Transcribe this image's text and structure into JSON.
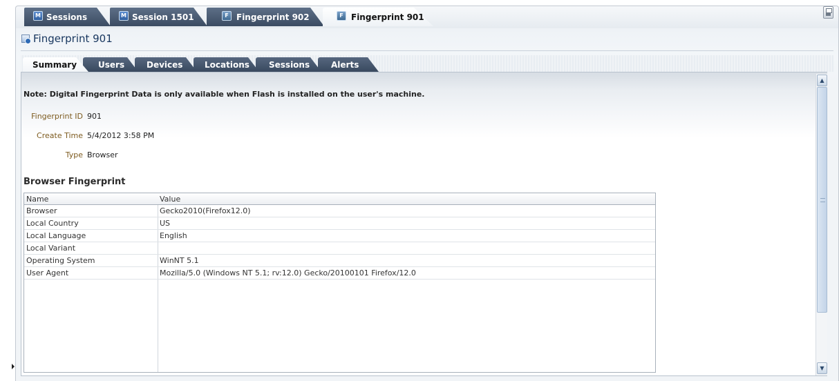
{
  "doc_tabs": [
    {
      "label": "Sessions",
      "icon": "session-icon"
    },
    {
      "label": "Session 1501",
      "icon": "session-icon"
    },
    {
      "label": "Fingerprint 902",
      "icon": "fingerprint-icon"
    },
    {
      "label": "Fingerprint 901",
      "icon": "fingerprint-icon",
      "active": true
    }
  ],
  "page": {
    "title": "Fingerprint 901",
    "icon": "fingerprint-icon"
  },
  "sub_tabs": [
    {
      "label": "Summary",
      "active": true
    },
    {
      "label": "Users"
    },
    {
      "label": "Devices"
    },
    {
      "label": "Locations"
    },
    {
      "label": "Sessions"
    },
    {
      "label": "Alerts"
    }
  ],
  "note": "Note: Digital Fingerprint Data is only available when Flash is installed on the user's machine.",
  "fields": [
    {
      "label": "Fingerprint ID",
      "value": "901"
    },
    {
      "label": "Create Time",
      "value": "5/4/2012 3:58 PM"
    },
    {
      "label": "Type",
      "value": "Browser"
    }
  ],
  "section_title": "Browser Fingerprint",
  "table": {
    "columns": [
      "Name",
      "Value"
    ],
    "rows": [
      [
        "Browser",
        "Gecko2010(Firefox12.0)"
      ],
      [
        "Local Country",
        "US"
      ],
      [
        "Local Language",
        "English"
      ],
      [
        "Local Variant",
        ""
      ],
      [
        "Operating System",
        "WinNT 5.1"
      ],
      [
        "User Agent",
        "Mozilla/5.0 (Windows NT 5.1; rv:12.0) Gecko/20100101 Firefox/12.0"
      ]
    ]
  },
  "scroll": {
    "up": "▲",
    "down": "▼"
  },
  "colors": {
    "active_tab_bg": "#ffffff",
    "inactive_tab_bg": "#3f4f66",
    "label_color": "#7d5b1f"
  }
}
